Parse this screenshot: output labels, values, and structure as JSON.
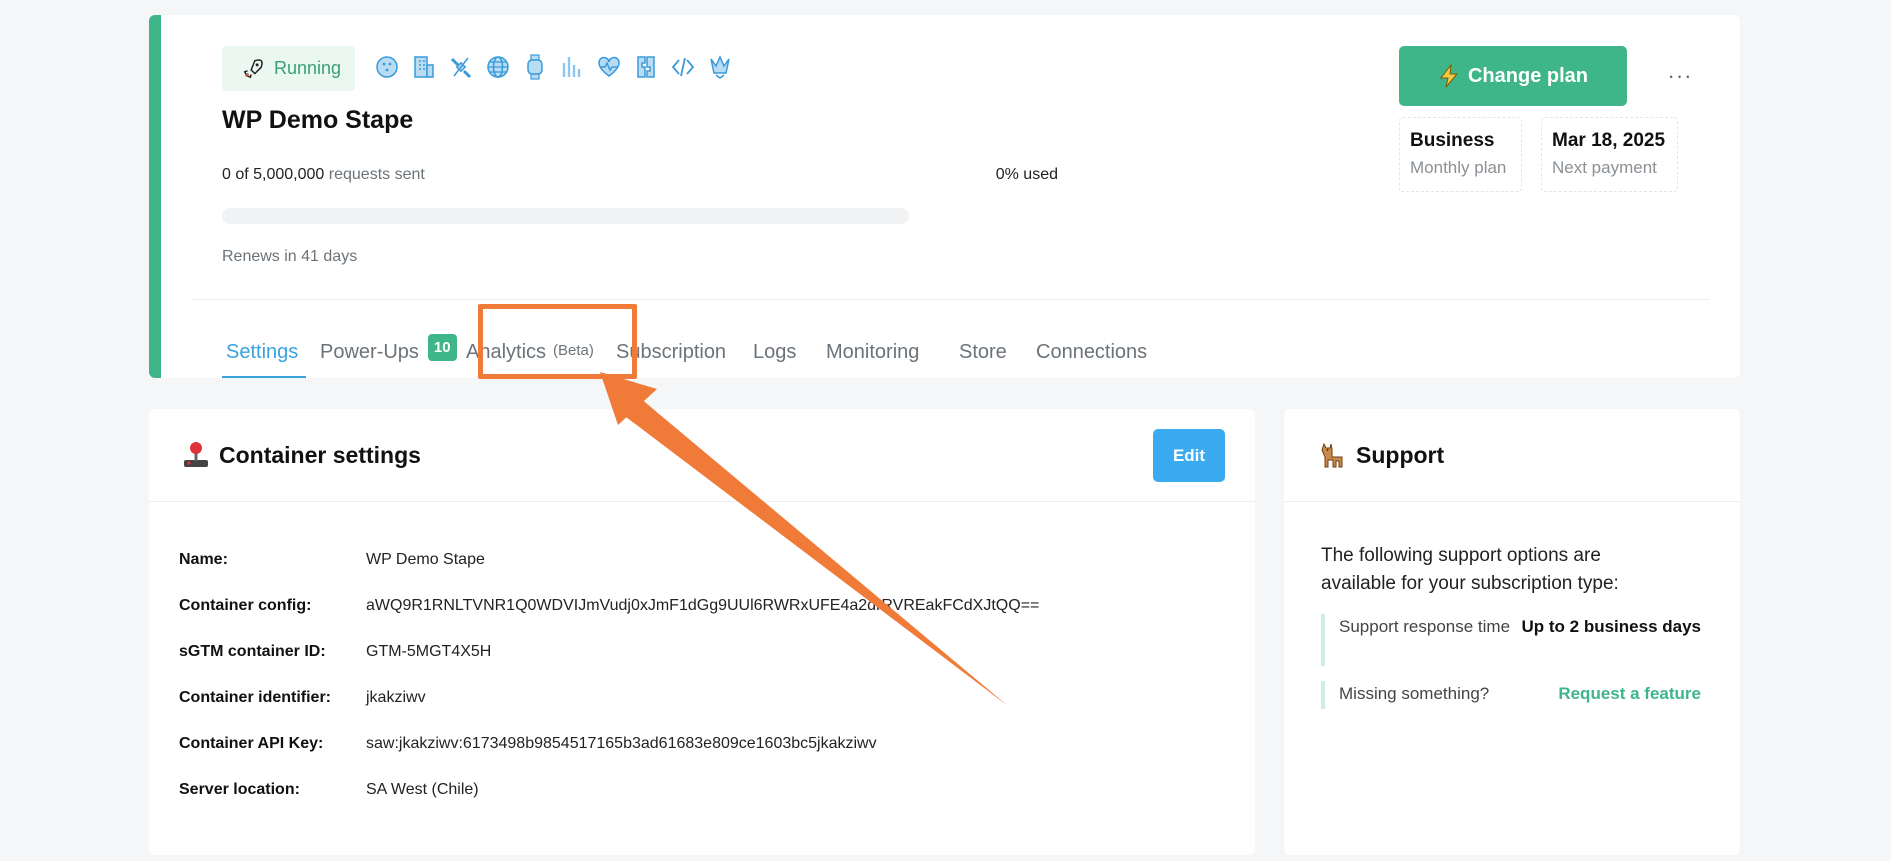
{
  "header": {
    "status": "Running",
    "container_name": "WP Demo Stape",
    "requests_count": "0 of 5,000,000",
    "requests_suffix": "requests sent",
    "usage_percent": "0% used",
    "usage_fraction": 0,
    "renews": "Renews in 41 days",
    "change_plan_label": "Change plan",
    "more_menu_label": "···",
    "plan": {
      "name": "Business",
      "period": "Monthly plan"
    },
    "next_payment": {
      "date": "Mar 18, 2025",
      "label": "Next payment"
    },
    "power_up_icons": [
      "globe-dots-icon",
      "building-icon",
      "satellite-icon",
      "world-icon",
      "watch-icon",
      "signal-bars-icon",
      "heart-pulse-icon",
      "puzzle-icon",
      "code-icon",
      "crown-icon"
    ]
  },
  "tabs": [
    {
      "label": "Settings",
      "active": true
    },
    {
      "label": "Power-Ups",
      "count": "10"
    },
    {
      "label": "Analytics",
      "suffix": "(Beta)"
    },
    {
      "label": "Subscription"
    },
    {
      "label": "Logs"
    },
    {
      "label": "Monitoring"
    },
    {
      "label": "Store"
    },
    {
      "label": "Connections"
    }
  ],
  "container_settings": {
    "title": "Container settings",
    "edit_label": "Edit",
    "rows": [
      {
        "key": "Name:",
        "value": "WP Demo Stape"
      },
      {
        "key": "Container config:",
        "value": "aWQ9R1RNLTVNR1Q0WDVIJmVudj0xJmF1dGg9UUl6RWRxUFE4a2drRVREakFCdXJtQQ=="
      },
      {
        "key": "sGTM container ID:",
        "value": "GTM-5MGT4X5H"
      },
      {
        "key": "Container identifier:",
        "value": "jkakziwv"
      },
      {
        "key": "Container API Key:",
        "value": "saw:jkakziwv:6173498b9854517165b3ad61683e809ce1603bc5jkakziwv"
      },
      {
        "key": "Server location:",
        "value": "SA West (Chile)"
      }
    ]
  },
  "support": {
    "title": "Support",
    "intro": "The following support options are available for your subscription type:",
    "rows": [
      {
        "key": "Support response time",
        "value": "Up to 2 business days"
      },
      {
        "key": "Missing something?",
        "value": "Request a feature"
      }
    ]
  },
  "colors": {
    "accent_green": "#3fb58a",
    "accent_blue": "#3aabf0",
    "annotation_orange": "#f07a38"
  }
}
